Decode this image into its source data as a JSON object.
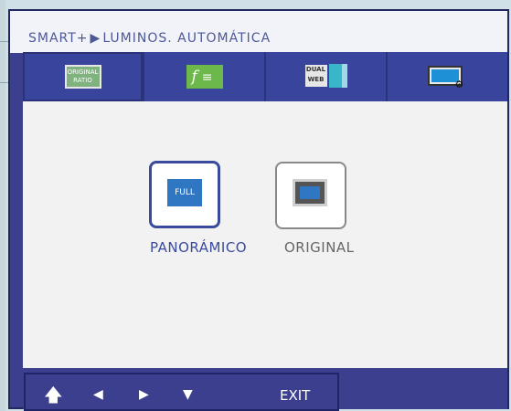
{
  "header": {
    "prefix": "SMART+",
    "arrow": "▶",
    "title": "LUMINOS. AUTOMÁTICA"
  },
  "tabs": [
    {
      "name": "original-ratio",
      "icon_text_top": "ORIGINAL",
      "icon_text_bottom": "RATIO",
      "active": true
    },
    {
      "name": "f-engine",
      "icon_text": "f"
    },
    {
      "name": "dual-web",
      "icon_text_top": "DUAL",
      "icon_text_bottom": "WEB"
    },
    {
      "name": "picture-mode"
    }
  ],
  "options": [
    {
      "label": "PANORÁMICO",
      "icon_text": "FULL",
      "selected": true
    },
    {
      "label": "ORIGINAL",
      "selected": false
    }
  ],
  "footer": {
    "exit_label": "EXIT"
  },
  "colors": {
    "accent": "#3a4b9e",
    "osd_frame": "#3b3f8d",
    "panel_bg": "#f2f2f2"
  }
}
